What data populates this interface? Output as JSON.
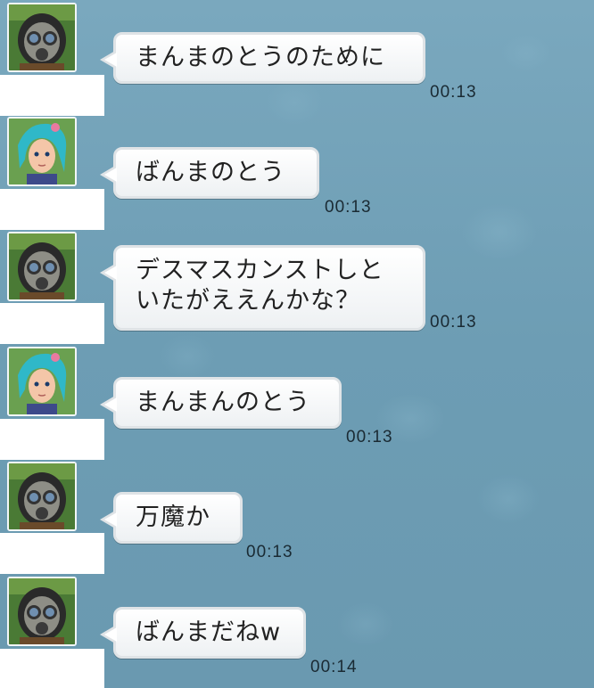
{
  "messages": [
    {
      "avatar": "gasmask-avatar",
      "text": "まんまのとうのために",
      "time": "00:13"
    },
    {
      "avatar": "blue-hair-girl-avatar",
      "text": "ばんまのとう",
      "time": "00:13"
    },
    {
      "avatar": "gasmask-avatar",
      "text_line1": "デスマスカンストしと",
      "text_line2": "いたがええんかな？",
      "time": "00:13"
    },
    {
      "avatar": "blue-hair-girl-avatar",
      "text": "まんまんのとう",
      "time": "00:13"
    },
    {
      "avatar": "gasmask-avatar",
      "text": "万魔か",
      "time": "00:13"
    },
    {
      "avatar": "gasmask-avatar",
      "text": "ばんまだねw",
      "time": "00:14"
    }
  ]
}
